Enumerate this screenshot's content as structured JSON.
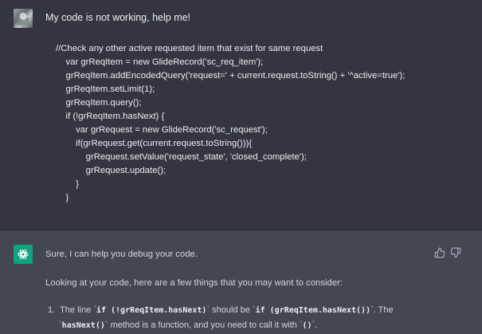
{
  "user_message": {
    "text": "My code is not working, help me!",
    "code_lines": [
      "//Check any other active requested item that exist for same request",
      "    var grReqItem = new GlideRecord('sc_req_item');",
      "    grReqItem.addEncodedQuery('request=' + current.request.toString() + '^active=true');",
      "    grReqItem.setLimit(1);",
      "    grReqItem.query();",
      "    if (!grReqItem.hasNext) {",
      "        var grRequest = new GlideRecord('sc_request');",
      "        if(grRequest.get(current.request.toString())){",
      "            grRequest.setValue('request_state', 'closed_complete');",
      "            grRequest.update();",
      "        }",
      "    }"
    ]
  },
  "assistant_message": {
    "intro": "Sure, I can help you debug your code.",
    "lead": "Looking at your code, here are a few things that you may want to consider:",
    "item1_prefix": "1.  The line `",
    "item1_code_a": "if (!grReqItem.hasNext)",
    "item1_mid": "` should be `",
    "item1_code_b": "if (grReqItem.hasNext())",
    "item1_suffix": "`. The",
    "item1_line2_prefix": "`",
    "item1_code_c": "hasNext()",
    "item1_line2_mid": "` method is a function, and you need to call it with `",
    "item1_code_d": "()",
    "item1_line2_suffix": "`."
  },
  "icons": {
    "user_avatar": "user-avatar",
    "assistant_avatar": "openai-logo-icon",
    "thumbs_up": "thumbs-up-icon",
    "thumbs_down": "thumbs-down-icon"
  },
  "colors": {
    "user_bg": "#343541",
    "assistant_bg": "#444654",
    "gpt_green": "#10a37f"
  }
}
